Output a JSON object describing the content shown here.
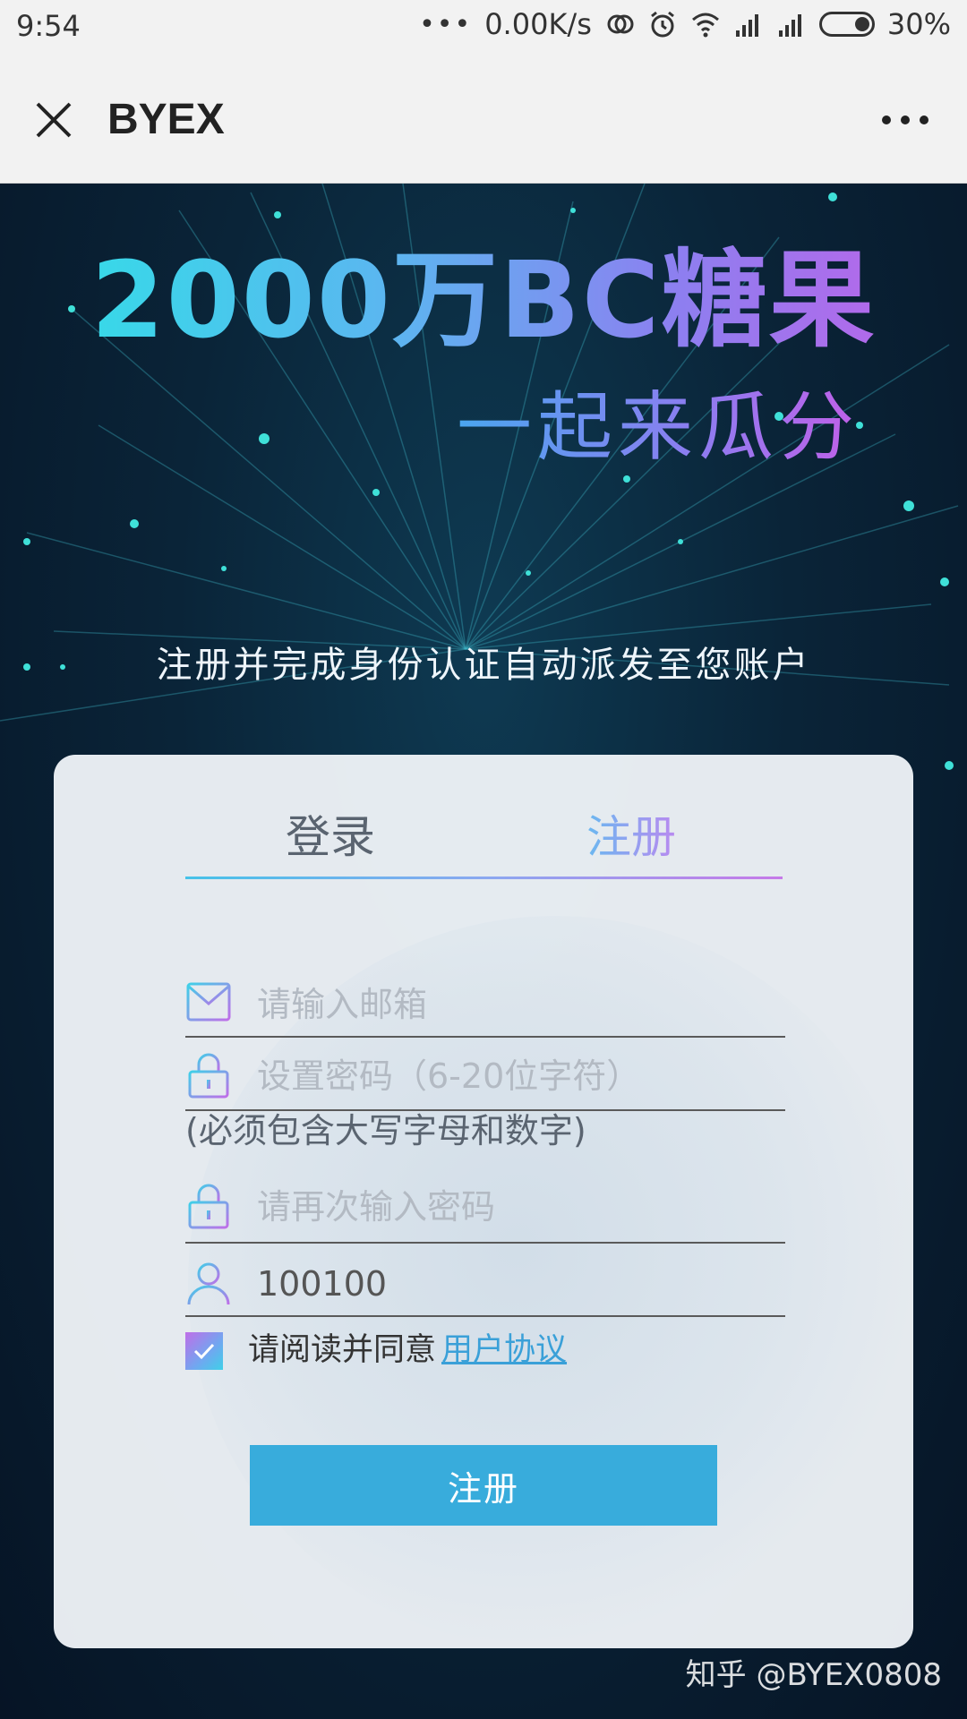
{
  "status_bar": {
    "time": "9:54",
    "dots": "•••",
    "speed": "0.00K/s",
    "battery": "30%"
  },
  "app_bar": {
    "title": "BYEX"
  },
  "hero": {
    "title": "2000万BC糖果",
    "subtitle": "一起来瓜分",
    "description": "注册并完成身份认证自动派发至您账户"
  },
  "tabs": {
    "login": "登录",
    "register": "注册"
  },
  "form": {
    "email_placeholder": "请输入邮箱",
    "password_placeholder": "设置密码（6-20位字符）",
    "password_hint": "(必须包含大写字母和数字)",
    "confirm_placeholder": "请再次输入密码",
    "invite_value": "100100",
    "agree_text": "请阅读并同意",
    "agree_link": "用户协议",
    "submit_label": "注册"
  },
  "watermark": "知乎 @BYEX0808",
  "colors": {
    "accent": "#38acdc",
    "gradient_start": "#2de3e6",
    "gradient_end": "#c260e8"
  }
}
